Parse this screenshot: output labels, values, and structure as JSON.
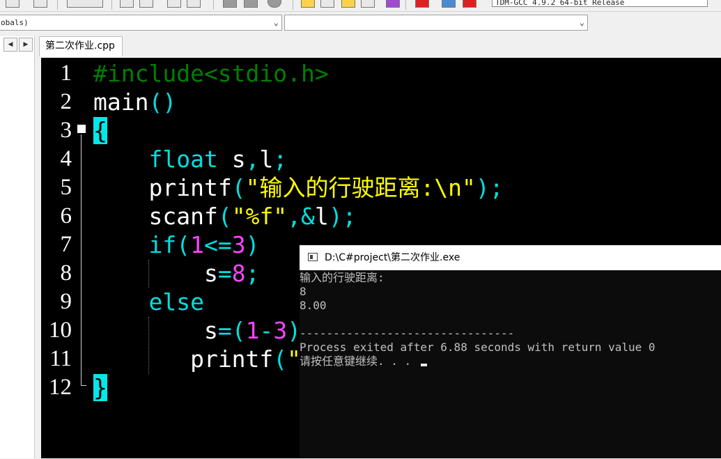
{
  "toolbar": {
    "compiler_select": "TDM-GCC 4.9.2 64-bit Release"
  },
  "combos": {
    "scope": "obals)",
    "function": ""
  },
  "tabs": [
    {
      "label": "第二次作业.cpp"
    }
  ],
  "editor": {
    "line_numbers": [
      "1",
      "2",
      "3",
      "4",
      "5",
      "6",
      "7",
      "8",
      "9",
      "10",
      "11",
      "12"
    ]
  },
  "console": {
    "title": "D:\\C#project\\第二次作业.exe",
    "lines": [
      "输入的行驶距离:",
      "8",
      "8.00",
      "",
      "--------------------------------",
      "Process exited after 6.88 seconds with return value 0",
      "请按任意键继续. . . "
    ]
  },
  "colors": {
    "editor_bg": "#000000",
    "preprocessor": "#008000",
    "keyword_symbol": "#00e0e0",
    "number": "#ff44ff",
    "string": "#ffff00",
    "brace_highlight": "#00e8e8",
    "console_bg": "#0c0c0c",
    "console_text": "#c0c0c0"
  }
}
